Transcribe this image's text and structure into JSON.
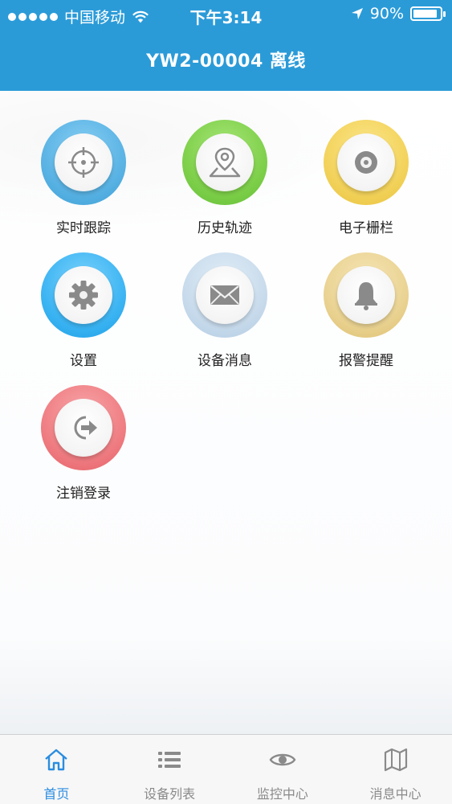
{
  "status_bar": {
    "carrier": "中国移动",
    "time": "下午3:14",
    "battery_text": "90%",
    "battery_level": 0.9,
    "icons": [
      "signal-dots-icon",
      "wifi-icon",
      "location-arrow-icon",
      "battery-icon"
    ]
  },
  "header": {
    "title": "YW2-00004 离线",
    "background_color": "#2b9bd8"
  },
  "menu": {
    "items": [
      {
        "label": "实时跟踪",
        "icon": "crosshair-icon",
        "color": "#5ab3e4"
      },
      {
        "label": "历史轨迹",
        "icon": "map-pin-icon",
        "color": "#7fd04b"
      },
      {
        "label": "电子栅栏",
        "icon": "disc-icon",
        "color": "#f3d35c"
      },
      {
        "label": "设置",
        "icon": "gear-icon",
        "color": "#3db5f3"
      },
      {
        "label": "设备消息",
        "icon": "envelope-icon",
        "color": "#c8dbec"
      },
      {
        "label": "报警提醒",
        "icon": "bell-icon",
        "color": "#ead393"
      },
      {
        "label": "注销登录",
        "icon": "logout-icon",
        "color": "#ef7e83"
      }
    ]
  },
  "tabbar": {
    "active_color": "#2b8de0",
    "tabs": [
      {
        "label": "首页",
        "icon": "home-icon",
        "active": true
      },
      {
        "label": "设备列表",
        "icon": "list-icon",
        "active": false
      },
      {
        "label": "监控中心",
        "icon": "eye-icon",
        "active": false
      },
      {
        "label": "消息中心",
        "icon": "map-icon",
        "active": false
      }
    ]
  }
}
